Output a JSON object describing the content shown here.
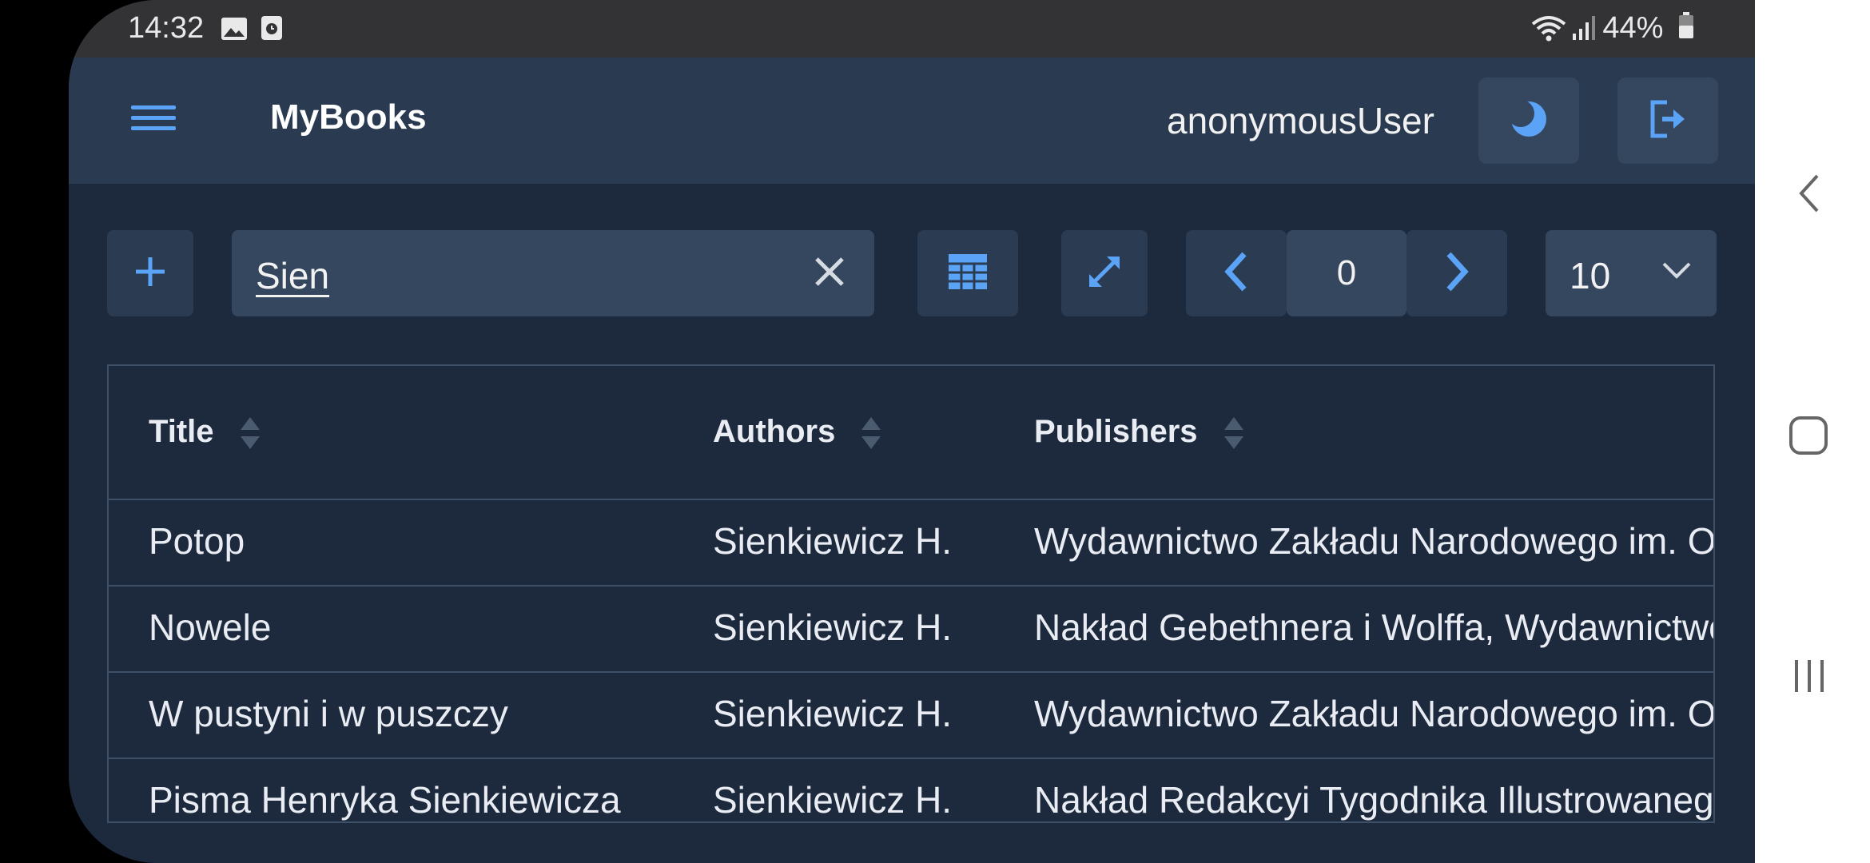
{
  "status_bar": {
    "time": "14:32",
    "battery": "44%",
    "icons": [
      "image-icon",
      "clock-icon",
      "wifi-icon",
      "signal-icon",
      "battery-icon"
    ]
  },
  "app_bar": {
    "title": "MyBooks",
    "username": "anonymousUser",
    "icons": [
      "menu-icon",
      "theme-toggle-icon",
      "logout-icon"
    ]
  },
  "toolbar": {
    "search_value": "Sien",
    "page_number": "0",
    "page_size": "10",
    "icons": [
      "plus-icon",
      "close-icon",
      "table-icon",
      "expand-icon",
      "chevron-left-icon",
      "chevron-right-icon",
      "chevron-down-icon"
    ]
  },
  "table": {
    "columns": [
      "Title",
      "Authors",
      "Publishers"
    ],
    "rows": [
      {
        "title": "Potop",
        "authors": "Sienkiewicz H.",
        "publishers": "Wydawnictwo Zakładu Narodowego im. Ossolińskich"
      },
      {
        "title": "Nowele",
        "authors": "Sienkiewicz H.",
        "publishers": "Nakład Gebethnera i Wolffa, Wydawnictwo"
      },
      {
        "title": "W pustyni i w puszczy",
        "authors": "Sienkiewicz H.",
        "publishers": "Wydawnictwo Zakładu Narodowego im. Ossolińskich"
      },
      {
        "title": "Pisma Henryka Sienkiewicza",
        "authors": "Sienkiewicz H.",
        "publishers": "Nakład Redakcyi Tygodnika Illustrowanego"
      }
    ]
  },
  "colors": {
    "accent": "#5aa3f6",
    "background": "#1d2a3d",
    "app_bar": "#293a51",
    "button": "#34475f"
  }
}
